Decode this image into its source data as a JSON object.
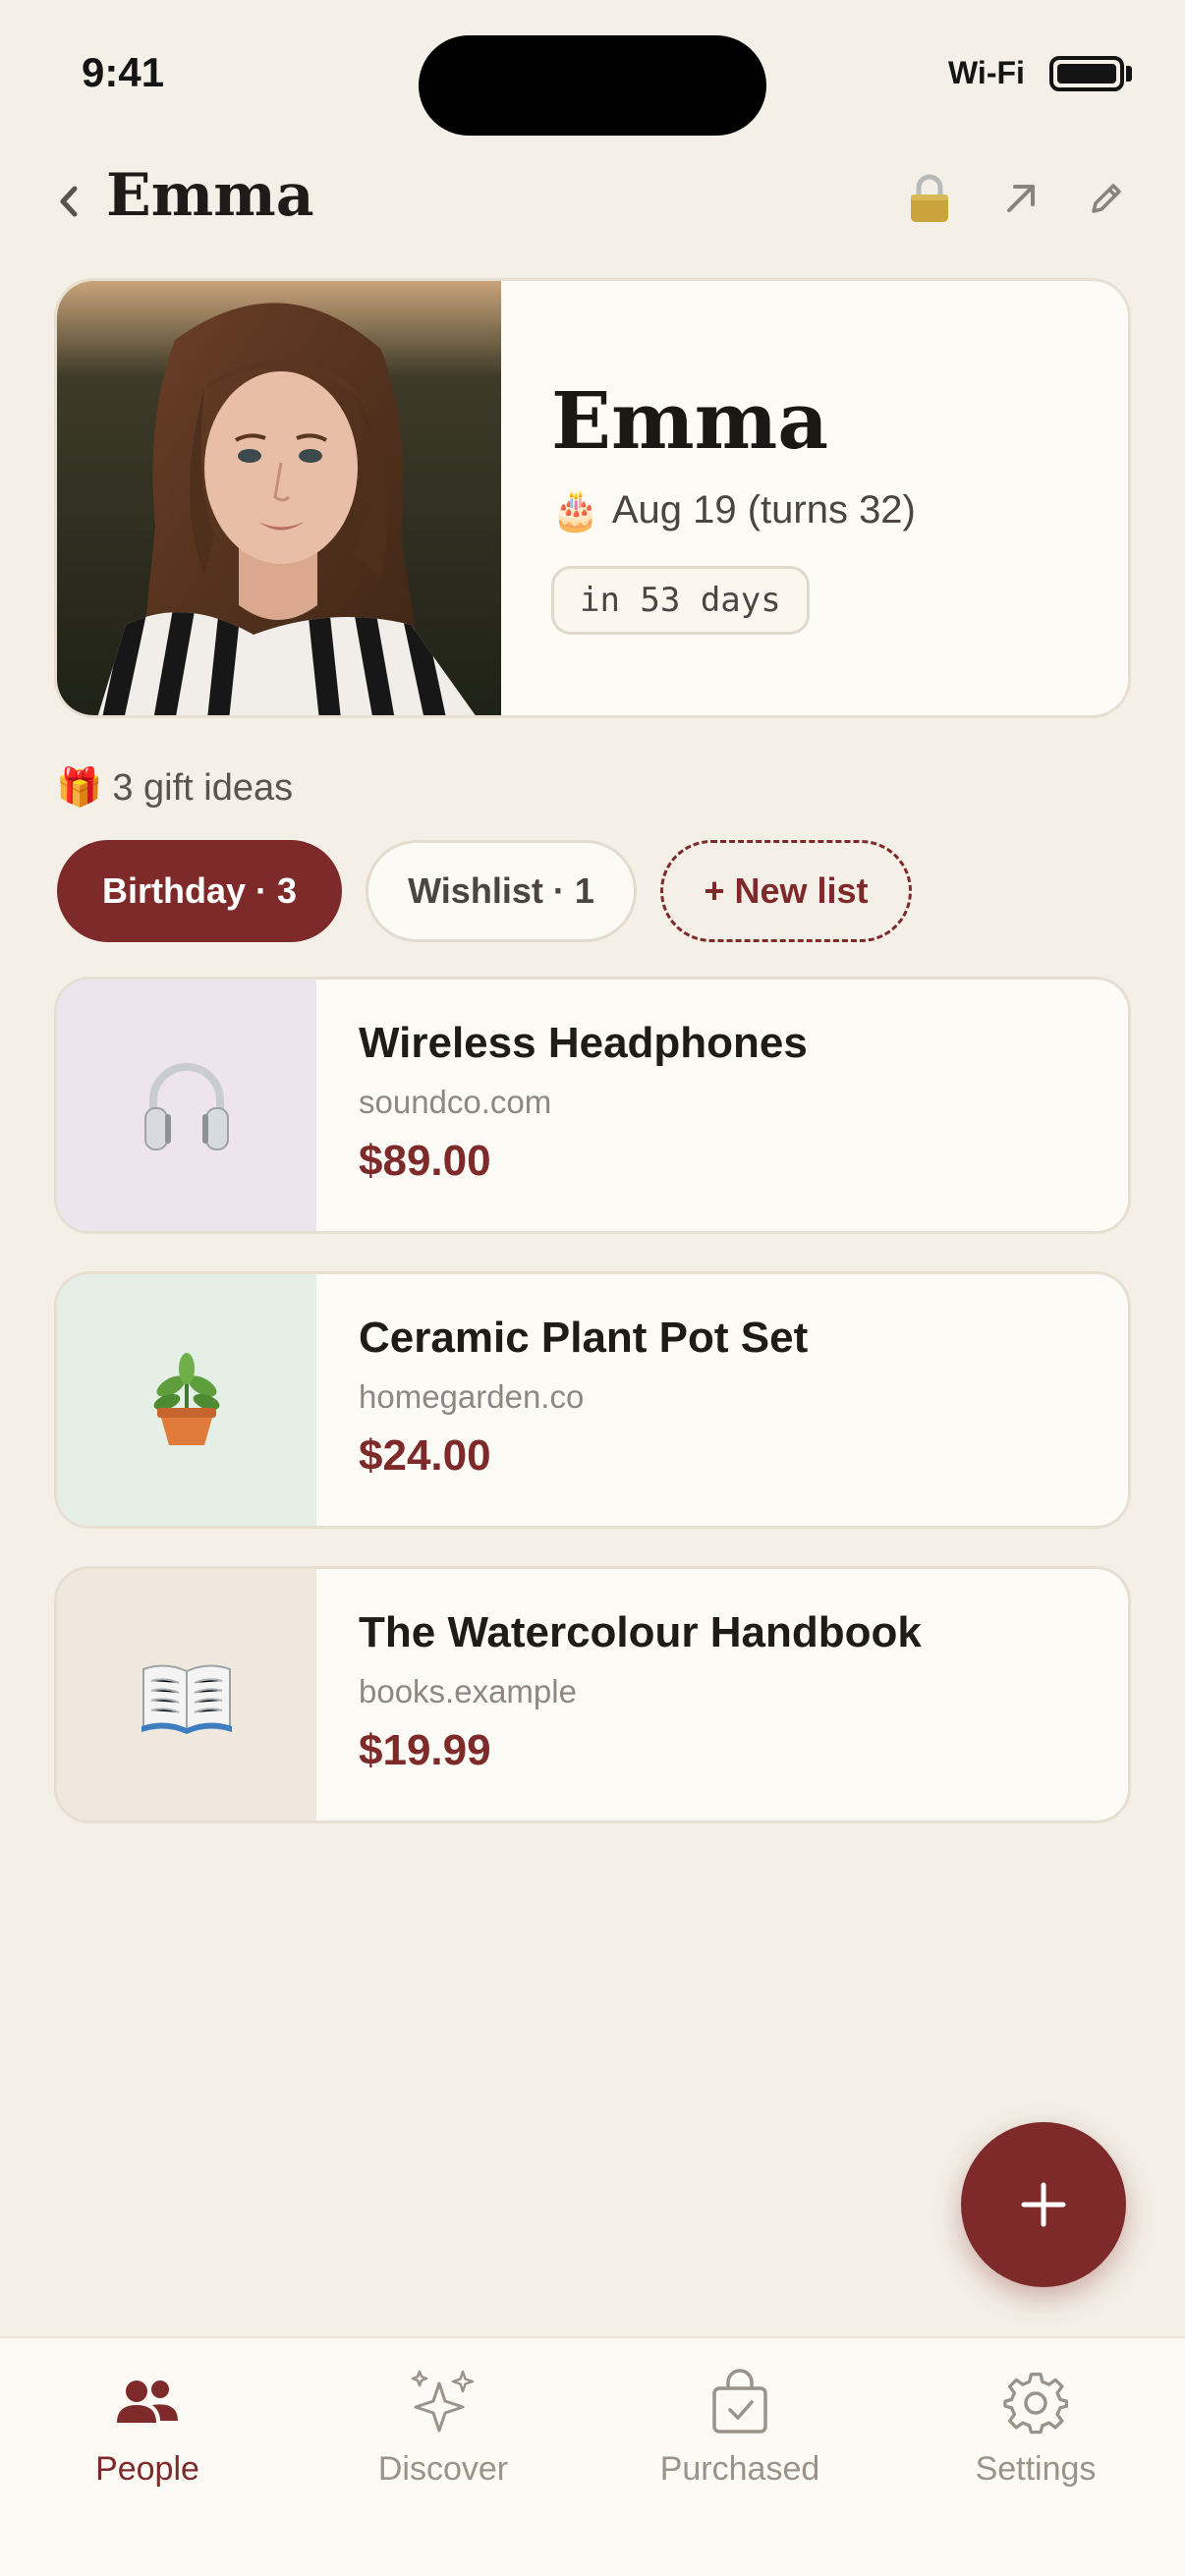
{
  "status_bar": {
    "time": "9:41",
    "wifi": "Wi-Fi"
  },
  "header": {
    "title": "Emma",
    "icons": [
      "back-chevron-icon",
      "lock-icon",
      "share-arrow-icon",
      "pencil-edit-icon"
    ]
  },
  "profile": {
    "name": "Emma",
    "birthday_emoji": "🎂",
    "birthday": "Aug 19 (turns 32)",
    "countdown": "in 53 days"
  },
  "gift_summary": {
    "emoji": "🎁",
    "text": "3 gift ideas"
  },
  "tabs": [
    {
      "label": "Birthday · 3",
      "active": true
    },
    {
      "label": "Wishlist · 1",
      "active": false
    },
    {
      "label": "+ New list",
      "active": false
    }
  ],
  "items": [
    {
      "name": "Wireless Headphones",
      "site": "soundco.com",
      "price": "$89.00",
      "emoji": "🎧",
      "thumb_bg": "#EEE4F0"
    },
    {
      "name": "Ceramic Plant Pot Set",
      "site": "homegarden.co",
      "price": "$24.00",
      "emoji": "🪴",
      "thumb_bg": "#E6EFE6"
    },
    {
      "name": "The Watercolour Handbook",
      "site": "books.example",
      "price": "$19.99",
      "emoji": "📖",
      "thumb_bg": "#F1E8DD"
    }
  ],
  "fab": {
    "icon": "plus-icon"
  },
  "bottom_nav": [
    {
      "label": "People",
      "icon": "people-icon",
      "active": true
    },
    {
      "label": "Discover",
      "icon": "sparkles-icon",
      "active": false
    },
    {
      "label": "Purchased",
      "icon": "shopping-bag-check-icon",
      "active": false
    },
    {
      "label": "Settings",
      "icon": "gear-icon",
      "active": false
    }
  ],
  "colors": {
    "accent": "#7E2A2A",
    "background": "#F4F0E7",
    "card": "#FDFBF6",
    "border": "#E6DFD2"
  }
}
